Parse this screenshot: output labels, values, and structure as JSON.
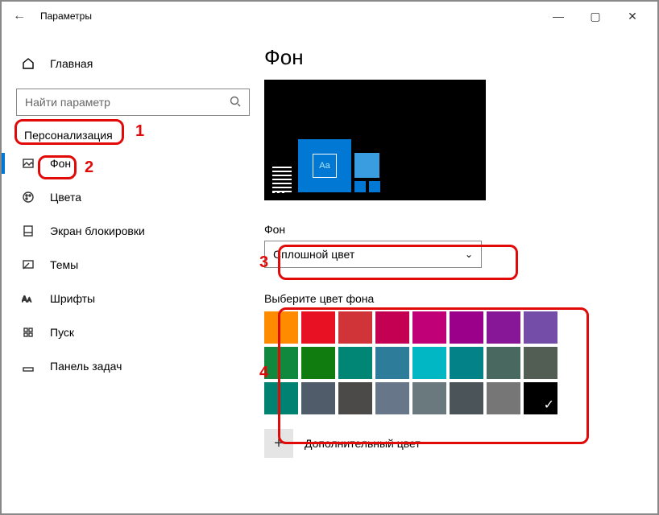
{
  "titlebar": {
    "title": "Параметры"
  },
  "sidebar": {
    "home_label": "Главная",
    "search_placeholder": "Найти параметр",
    "category": "Персонализация",
    "items": [
      {
        "label": "Фон",
        "selected": true
      },
      {
        "label": "Цвета"
      },
      {
        "label": "Экран блокировки"
      },
      {
        "label": "Темы"
      },
      {
        "label": "Шрифты"
      },
      {
        "label": "Пуск"
      },
      {
        "label": "Панель задач"
      }
    ]
  },
  "content": {
    "heading": "Фон",
    "preview_sample_text": "Aa",
    "background_label": "Фон",
    "background_dropdown_value": "Сплошной цвет",
    "palette_label": "Выберите цвет фона",
    "add_color_label": "Дополнительный цвет",
    "colors": [
      "#ff8c00",
      "#e81123",
      "#d13438",
      "#c30052",
      "#bf0077",
      "#9a0089",
      "#881798",
      "#744da9",
      "#10893e",
      "#107c10",
      "#018574",
      "#2d7d9a",
      "#00b7c3",
      "#038387",
      "#486860",
      "#525e54",
      "#008272",
      "#515c6b",
      "#4c4a48",
      "#68768a",
      "#69797e",
      "#4a5459",
      "#767676",
      "#000000"
    ],
    "selected_color_index": 23
  },
  "annotations": {
    "1": "1",
    "2": "2",
    "3": "3",
    "4": "4"
  }
}
